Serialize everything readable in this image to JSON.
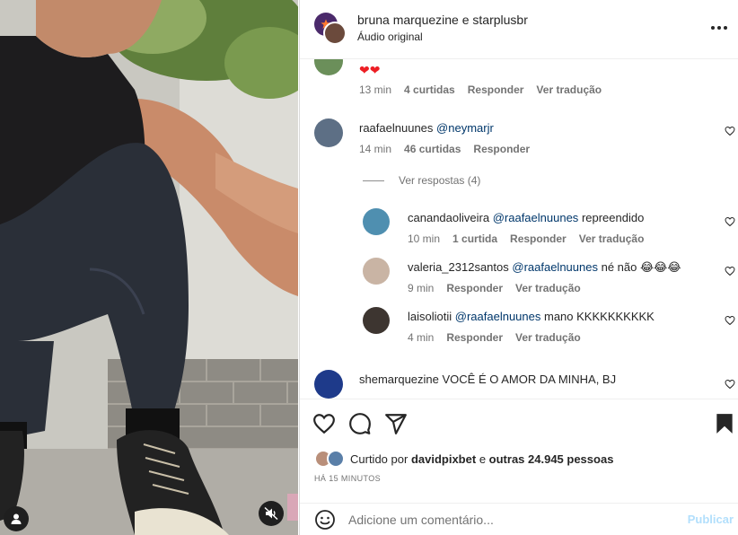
{
  "header": {
    "username_line": "bruna marquezine e starplusbr",
    "audio_label": "Áudio original"
  },
  "comments": [
    {
      "text_emoji": "❤❤",
      "time": "13 min",
      "likes": "4 curtidas",
      "reply": "Responder",
      "translate": "Ver tradução"
    },
    {
      "user": "raafaelnuunes",
      "mention": "@neymarjr",
      "text": "",
      "time": "14 min",
      "likes": "46 curtidas",
      "reply": "Responder"
    }
  ],
  "view_replies": "Ver respostas (4)",
  "replies": [
    {
      "user": "canandaoliveira",
      "mention": "@raafaelnuunes",
      "text": "repreendido",
      "time": "10 min",
      "likes": "1 curtida",
      "reply": "Responder",
      "translate": "Ver tradução"
    },
    {
      "user": "valeria_2312santos",
      "mention": "@raafaelnuunes",
      "text": "né não 😂😂😂",
      "time": "9 min",
      "reply": "Responder",
      "translate": "Ver tradução"
    },
    {
      "user": "laisoliotii",
      "mention": "@raafaelnuunes",
      "text": "mano KKKKKKKKKK",
      "time": "4 min",
      "reply": "Responder",
      "translate": "Ver tradução"
    }
  ],
  "last_comment": {
    "user": "shemarquezine",
    "text": "VOCÊ É O AMOR DA MINHA, BJ"
  },
  "likes_summary": {
    "prefix": "Curtido por",
    "user": "davidpixbet",
    "middle": "e",
    "others": "outras 24.945 pessoas"
  },
  "time_ago": "HÁ 15 MINUTOS",
  "add_comment": {
    "placeholder": "Adicione um comentário...",
    "publish_label": "Publicar"
  },
  "icons": {
    "like": "heart-icon",
    "comment": "comment-icon",
    "share": "paper-plane-icon",
    "save": "bookmark-icon",
    "emoji": "emoji-icon",
    "more": "more-icon",
    "mute": "muted-speaker-icon",
    "user_tag": "user-icon"
  },
  "colors": {
    "mention": "#00376b",
    "publish_disabled": "#b2dffc",
    "secondary_text": "#737373",
    "heart_red": "#ed1e24"
  }
}
